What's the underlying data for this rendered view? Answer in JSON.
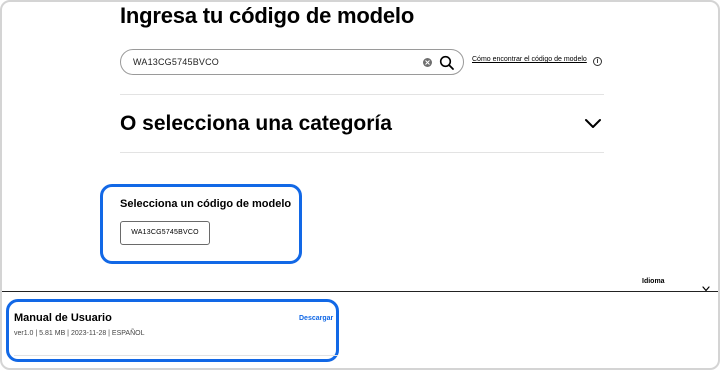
{
  "header": {
    "title": "Ingresa tu código de modelo"
  },
  "search": {
    "value": "WA13CG5745BVCO",
    "help_link": "Cómo encontrar el código de modelo",
    "info_glyph": "i"
  },
  "category": {
    "title": "O selecciona una categoría"
  },
  "model_selection": {
    "label": "Selecciona un código de modelo",
    "chip": "WA13CG5745BVCO"
  },
  "language": {
    "label": "Idioma"
  },
  "manual": {
    "title": "Manual de Usuario",
    "meta": "ver1.0 | 5.81 MB | 2023-11-28 | ESPAÑOL",
    "download_label": "Descargar"
  },
  "colors": {
    "highlight": "#1268e6",
    "text": "#000000",
    "divider": "#e3e3e3"
  },
  "icons": {
    "clear": "clear-icon",
    "search": "search-icon",
    "info": "info-icon",
    "category_toggle": "chevron-down-icon",
    "language_toggle": "chevron-down-icon"
  }
}
